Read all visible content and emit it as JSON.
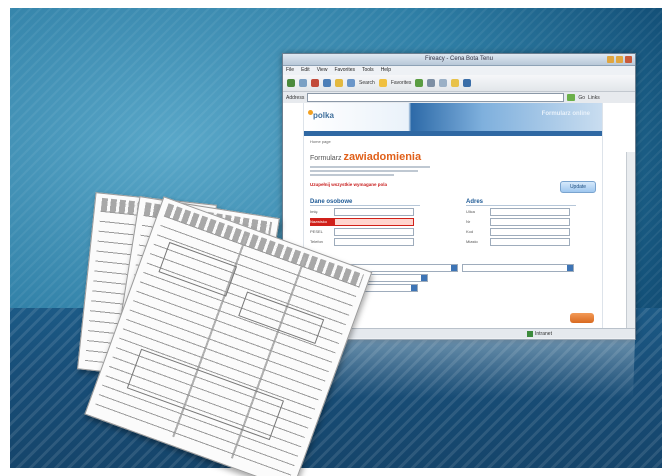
{
  "browser": {
    "window_title": "Fireacy - Cena Bota Tenu",
    "menu_items": [
      "File",
      "Edit",
      "View",
      "Favorites",
      "Tools",
      "Help"
    ],
    "toolbar": {
      "search_label": "Search",
      "favorites_label": "Favorites"
    },
    "address_label": "Address",
    "go_label": "Go",
    "links_label": "Links",
    "status_text": "Intranet"
  },
  "site": {
    "logo_text": "polka",
    "banner_text": "Formularz online",
    "breadcrumb": "Home page",
    "headline_prefix": "Formularz",
    "headline_highlight": "zawiadomienia",
    "alert_text": "Uzupełnij wszystkie wymagane pola",
    "update_button": "Update",
    "left_section_title": "Dane osobowe",
    "right_section_title": "Adres",
    "left_fields": [
      "Imię",
      "Nazwisko",
      "PESEL",
      "Telefon"
    ],
    "right_fields": [
      "Ulica",
      "Nr",
      "Kod",
      "Miasto"
    ]
  },
  "colors": {
    "background": "#2f7fa6",
    "accent_orange": "#e0601a",
    "error_red": "#d0201a",
    "link_blue": "#1e5a96"
  }
}
